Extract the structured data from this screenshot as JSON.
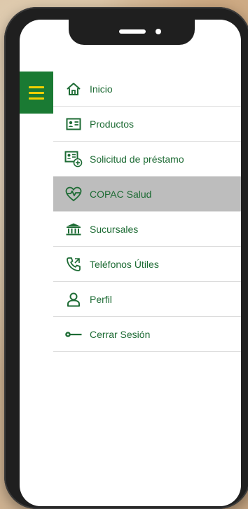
{
  "menu": {
    "toggle_icon": "hamburger-icon",
    "items": [
      {
        "label": "Inicio",
        "icon": "home-icon",
        "active": false
      },
      {
        "label": "Productos",
        "icon": "id-card-icon",
        "active": false
      },
      {
        "label": "Solicitud de préstamo",
        "icon": "loan-request-icon",
        "active": false
      },
      {
        "label": "COPAC Salud",
        "icon": "heart-pulse-icon",
        "active": true
      },
      {
        "label": "Sucursales",
        "icon": "bank-icon",
        "active": false
      },
      {
        "label": "Teléfonos Útiles",
        "icon": "phone-icon",
        "active": false
      },
      {
        "label": "Perfil",
        "icon": "user-icon",
        "active": false
      },
      {
        "label": "Cerrar Sesión",
        "icon": "key-icon",
        "active": false
      }
    ]
  },
  "colors": {
    "brand_green": "#1a7a33",
    "text_green": "#1d6b34",
    "hamburger_yellow": "#f1d000",
    "active_bg": "#bdbdbd",
    "divider": "#dcdcdc"
  }
}
